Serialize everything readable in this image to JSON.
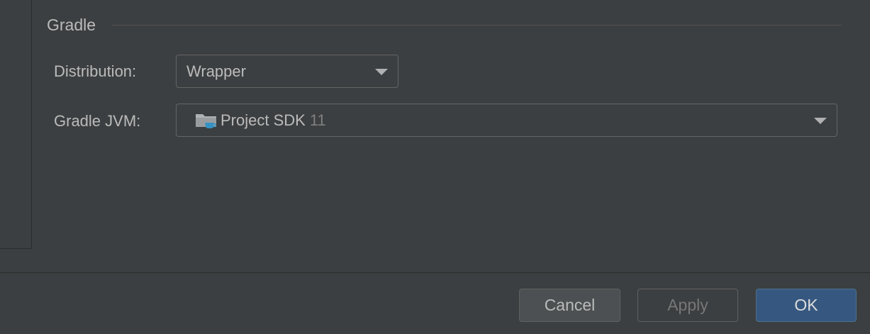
{
  "section": {
    "title": "Gradle"
  },
  "distribution": {
    "label": "Distribution:",
    "value": "Wrapper"
  },
  "gradle_jvm": {
    "label": "Gradle JVM:",
    "value": "Project SDK",
    "version": "11",
    "icon": "jdk-folder-icon"
  },
  "buttons": {
    "cancel": "Cancel",
    "apply": "Apply",
    "ok": "OK"
  },
  "colors": {
    "background": "#3c3f41",
    "primary_button": "#365880",
    "text": "#bbbbbb",
    "muted_text": "#808080",
    "icon_accent": "#3592c4"
  }
}
